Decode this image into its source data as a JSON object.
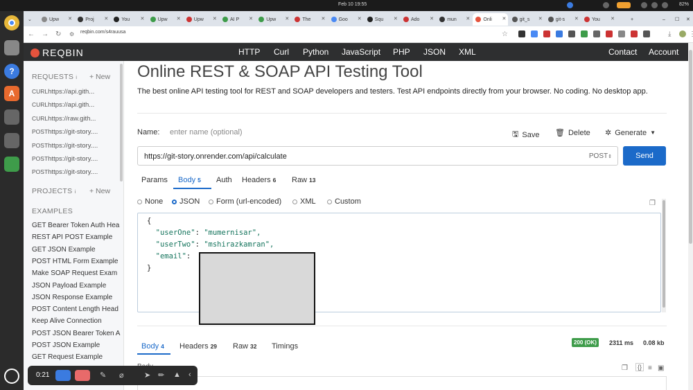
{
  "system": {
    "date": "Feb 10  19:55",
    "battery": "82%"
  },
  "browser": {
    "tabs": [
      "Upw",
      "Proj",
      "You",
      "Upw",
      "Upw",
      "AI P",
      "Upw",
      "The",
      "Goo",
      "Squ",
      "Ado",
      "mun",
      "Onli",
      "git_s",
      "git-s",
      "You"
    ],
    "url": "reqbin.com/s4rauusa"
  },
  "nav": {
    "logo": "REQBIN",
    "items": [
      "HTTP",
      "Curl",
      "Python",
      "JavaScript",
      "PHP",
      "JSON",
      "XML"
    ],
    "right": [
      "Contact",
      "Account"
    ]
  },
  "sidebar": {
    "requests_title": "REQUESTS",
    "requests_count": "i",
    "new_label": "+ New",
    "requests": [
      {
        "method": "CURL",
        "url": "https://api.gith..."
      },
      {
        "method": "CURL",
        "url": "https://api.gith..."
      },
      {
        "method": "CURL",
        "url": "https://raw.gith..."
      },
      {
        "method": "POST",
        "url": "https://git-story...."
      },
      {
        "method": "POST",
        "url": "https://git-story...."
      },
      {
        "method": "POST",
        "url": "https://git-story...."
      },
      {
        "method": "POST",
        "url": "https://git-story...."
      }
    ],
    "projects_title": "PROJECTS",
    "projects_count": "i",
    "examples_title": "EXAMPLES",
    "examples": [
      "GET Bearer Token Auth Hea",
      "REST API POST Example",
      "GET JSON Example",
      "POST HTML Form Example",
      "Make SOAP Request Exam",
      "JSON Payload Example",
      "JSON Response Example",
      "POST Content Length Head",
      "Keep Alive Connection",
      "POST JSON Bearer Token A",
      "POST JSON Example",
      "GET Request Example"
    ]
  },
  "main": {
    "title": "Online REST & SOAP API Testing Tool",
    "description": "The best online API testing tool for REST and SOAP developers and testers. Test API endpoints directly from your browser. No coding. No desktop app.",
    "name_label": "Name:",
    "name_placeholder": "enter name (optional)",
    "save": "Save",
    "delete": "Delete",
    "generate": "Generate",
    "url": "https://git-story.onrender.com/api/calculate",
    "method": "POST",
    "send": "Send",
    "request_tabs": [
      {
        "label": "Params",
        "count": ""
      },
      {
        "label": "Body",
        "count": "5"
      },
      {
        "label": "Auth",
        "count": ""
      },
      {
        "label": "Headers",
        "count": "6"
      },
      {
        "label": "Raw",
        "count": "13"
      }
    ],
    "body_types": [
      "None",
      "JSON",
      "Form (url-encoded)",
      "XML",
      "Custom"
    ],
    "body_selected": "JSON",
    "body_lines": {
      "open": "{",
      "k1": "\"userOne\"",
      "v1": "\"mumernisar\",",
      "k2": "\"userTwo\"",
      "v2": "\"mshirazkamran\",",
      "k3": "\"email\"",
      "close": "}"
    },
    "response_tabs": [
      {
        "label": "Body",
        "count": "4"
      },
      {
        "label": "Headers",
        "count": "29"
      },
      {
        "label": "Raw",
        "count": "32"
      },
      {
        "label": "Timings",
        "count": ""
      }
    ],
    "status": "200 (OK)",
    "time": "2311 ms",
    "size": "0.08 kb",
    "response_body_label": "Body"
  },
  "recorder": {
    "time": "0:21"
  }
}
